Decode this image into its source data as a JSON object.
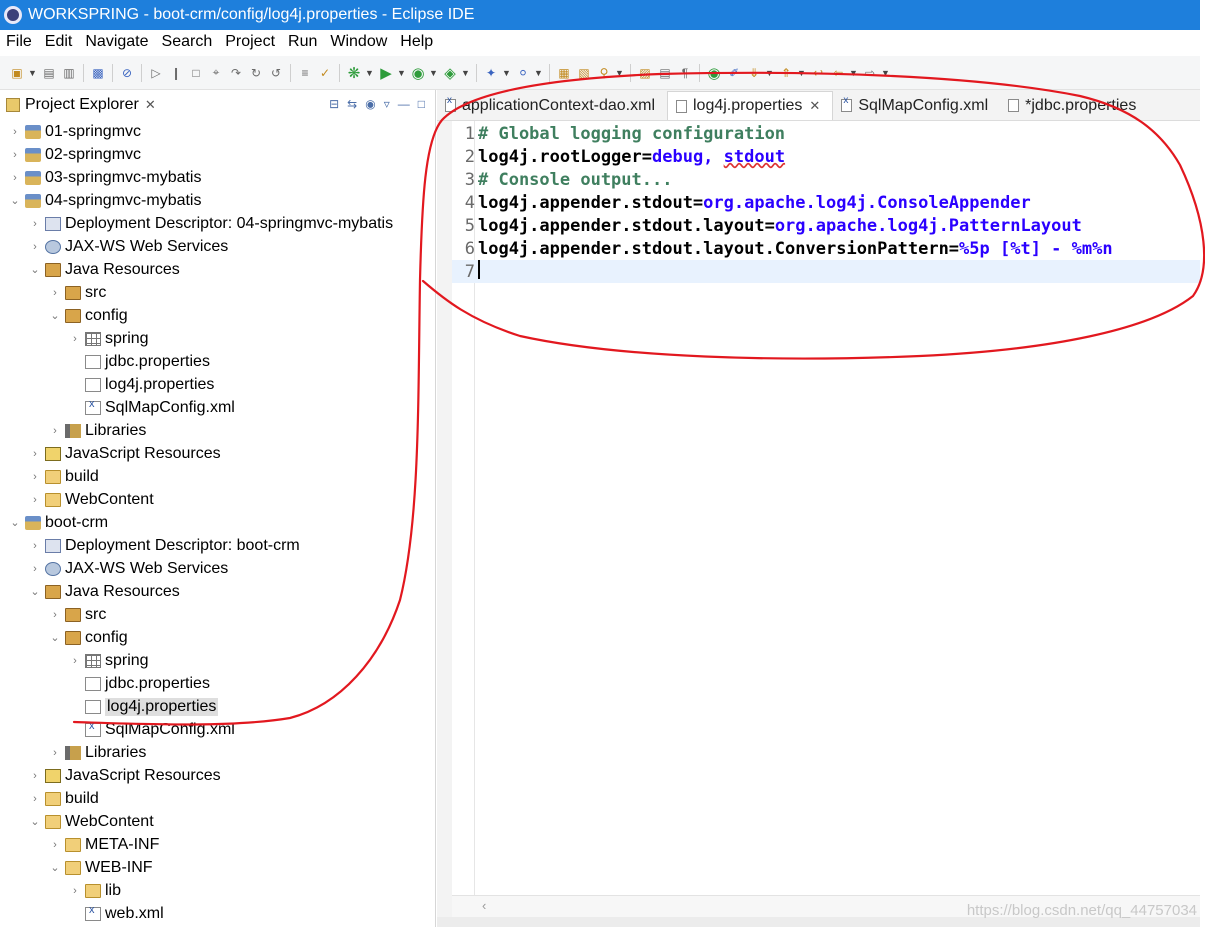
{
  "window": {
    "title": "WORKSPRING - boot-crm/config/log4j.properties - Eclipse IDE"
  },
  "menu": [
    "File",
    "Edit",
    "Navigate",
    "Search",
    "Project",
    "Run",
    "Window",
    "Help"
  ],
  "toolbar": {
    "icons": [
      "new-icon",
      "save-icon",
      "save-all-icon",
      "console-icon",
      "skip-breakpoints-icon",
      "resume-icon",
      "suspend-icon",
      "terminate-icon",
      "debug-icon",
      "run-icon",
      "coverage-icon",
      "external-tools-icon",
      "new-java-project-icon",
      "new-class-icon",
      "open-type-icon",
      "search-icon",
      "back-icon",
      "forward-icon"
    ]
  },
  "explorer": {
    "title": "Project Explorer",
    "items": [
      {
        "label": "01-springmvc",
        "icon": "project-icon",
        "depth": 0,
        "expanded": false
      },
      {
        "label": "02-springmvc",
        "icon": "project-icon",
        "depth": 0,
        "expanded": false
      },
      {
        "label": "03-springmvc-mybatis",
        "icon": "project-icon",
        "depth": 0,
        "expanded": false
      },
      {
        "label": "04-springmvc-mybatis",
        "icon": "project-icon",
        "depth": 0,
        "expanded": true
      },
      {
        "label": "Deployment Descriptor: 04-springmvc-mybatis",
        "icon": "descriptor-icon",
        "depth": 1,
        "expanded": false
      },
      {
        "label": "JAX-WS Web Services",
        "icon": "webservice-icon",
        "depth": 1,
        "expanded": false
      },
      {
        "label": "Java Resources",
        "icon": "java-resources-icon",
        "depth": 1,
        "expanded": true
      },
      {
        "label": "src",
        "icon": "source-folder-icon",
        "depth": 2,
        "expanded": false
      },
      {
        "label": "config",
        "icon": "source-folder-icon",
        "depth": 2,
        "expanded": true
      },
      {
        "label": "spring",
        "icon": "package-icon",
        "depth": 3,
        "expanded": false
      },
      {
        "label": "jdbc.properties",
        "icon": "properties-file-icon",
        "depth": 3,
        "leaf": true
      },
      {
        "label": "log4j.properties",
        "icon": "properties-file-icon",
        "depth": 3,
        "leaf": true
      },
      {
        "label": "SqlMapConfig.xml",
        "icon": "xml-file-icon",
        "depth": 3,
        "leaf": true
      },
      {
        "label": "Libraries",
        "icon": "libraries-icon",
        "depth": 2,
        "expanded": false
      },
      {
        "label": "JavaScript Resources",
        "icon": "javascript-icon",
        "depth": 1,
        "expanded": false
      },
      {
        "label": "build",
        "icon": "folder-icon",
        "depth": 1,
        "expanded": false
      },
      {
        "label": "WebContent",
        "icon": "folder-icon",
        "depth": 1,
        "expanded": false
      },
      {
        "label": "boot-crm",
        "icon": "project-icon",
        "depth": 0,
        "expanded": true
      },
      {
        "label": "Deployment Descriptor: boot-crm",
        "icon": "descriptor-icon",
        "depth": 1,
        "expanded": false
      },
      {
        "label": "JAX-WS Web Services",
        "icon": "webservice-icon",
        "depth": 1,
        "expanded": false
      },
      {
        "label": "Java Resources",
        "icon": "java-resources-icon",
        "depth": 1,
        "expanded": true
      },
      {
        "label": "src",
        "icon": "source-folder-icon",
        "depth": 2,
        "expanded": false
      },
      {
        "label": "config",
        "icon": "source-folder-icon",
        "depth": 2,
        "expanded": true
      },
      {
        "label": "spring",
        "icon": "package-icon",
        "depth": 3,
        "expanded": false
      },
      {
        "label": "jdbc.properties",
        "icon": "properties-file-icon",
        "depth": 3,
        "leaf": true
      },
      {
        "label": "log4j.properties",
        "icon": "properties-file-icon",
        "depth": 3,
        "leaf": true,
        "selected": true
      },
      {
        "label": "SqlMapConfig.xml",
        "icon": "xml-file-icon",
        "depth": 3,
        "leaf": true
      },
      {
        "label": "Libraries",
        "icon": "libraries-icon",
        "depth": 2,
        "expanded": false
      },
      {
        "label": "JavaScript Resources",
        "icon": "javascript-icon",
        "depth": 1,
        "expanded": false
      },
      {
        "label": "build",
        "icon": "folder-icon",
        "depth": 1,
        "expanded": false
      },
      {
        "label": "WebContent",
        "icon": "folder-icon",
        "depth": 1,
        "expanded": true
      },
      {
        "label": "META-INF",
        "icon": "folder-icon",
        "depth": 2,
        "expanded": false
      },
      {
        "label": "WEB-INF",
        "icon": "folder-icon",
        "depth": 2,
        "expanded": true
      },
      {
        "label": "lib",
        "icon": "folder-icon",
        "depth": 3,
        "expanded": false
      },
      {
        "label": "web.xml",
        "icon": "xml-file-icon",
        "depth": 3,
        "leaf": true
      }
    ]
  },
  "editor": {
    "tabs": [
      {
        "label": "applicationContext-dao.xml",
        "icon": "xml-file-icon",
        "active": false
      },
      {
        "label": "log4j.properties",
        "icon": "properties-file-icon",
        "active": true,
        "closable": true
      },
      {
        "label": "SqlMapConfig.xml",
        "icon": "xml-file-icon",
        "active": false
      },
      {
        "label": "*jdbc.properties",
        "icon": "properties-file-icon",
        "active": false
      }
    ],
    "lines": [
      {
        "num": "1",
        "parts": [
          {
            "t": "# Global logging configuration",
            "c": "comment"
          }
        ]
      },
      {
        "num": "2",
        "parts": [
          {
            "t": "log4j.rootLogger=",
            "c": "key"
          },
          {
            "t": "debug, stdout",
            "c": "val-b",
            "squiggle": "stdout"
          }
        ]
      },
      {
        "num": "3",
        "parts": [
          {
            "t": "# Console output...",
            "c": "comment"
          }
        ]
      },
      {
        "num": "4",
        "parts": [
          {
            "t": "log4j.appender.stdout=",
            "c": "key"
          },
          {
            "t": "org.apache.log4j.ConsoleAppender",
            "c": "val-b"
          }
        ]
      },
      {
        "num": "5",
        "parts": [
          {
            "t": "log4j.appender.stdout.layout=",
            "c": "key"
          },
          {
            "t": "org.apache.log4j.PatternLayout",
            "c": "val-b"
          }
        ]
      },
      {
        "num": "6",
        "parts": [
          {
            "t": "log4j.appender.stdout.layout.ConversionPattern=",
            "c": "key"
          },
          {
            "t": "%5p [%t] - %m%n",
            "c": "val-b"
          }
        ]
      },
      {
        "num": "7",
        "parts": [],
        "current": true
      }
    ]
  },
  "watermark": "https://blog.csdn.net/qq_44757034",
  "colors": {
    "titlebar": "#1e7fdc",
    "annotation": "#e2181f",
    "comment": "#3f7f5f",
    "value": "#2a00ff"
  }
}
